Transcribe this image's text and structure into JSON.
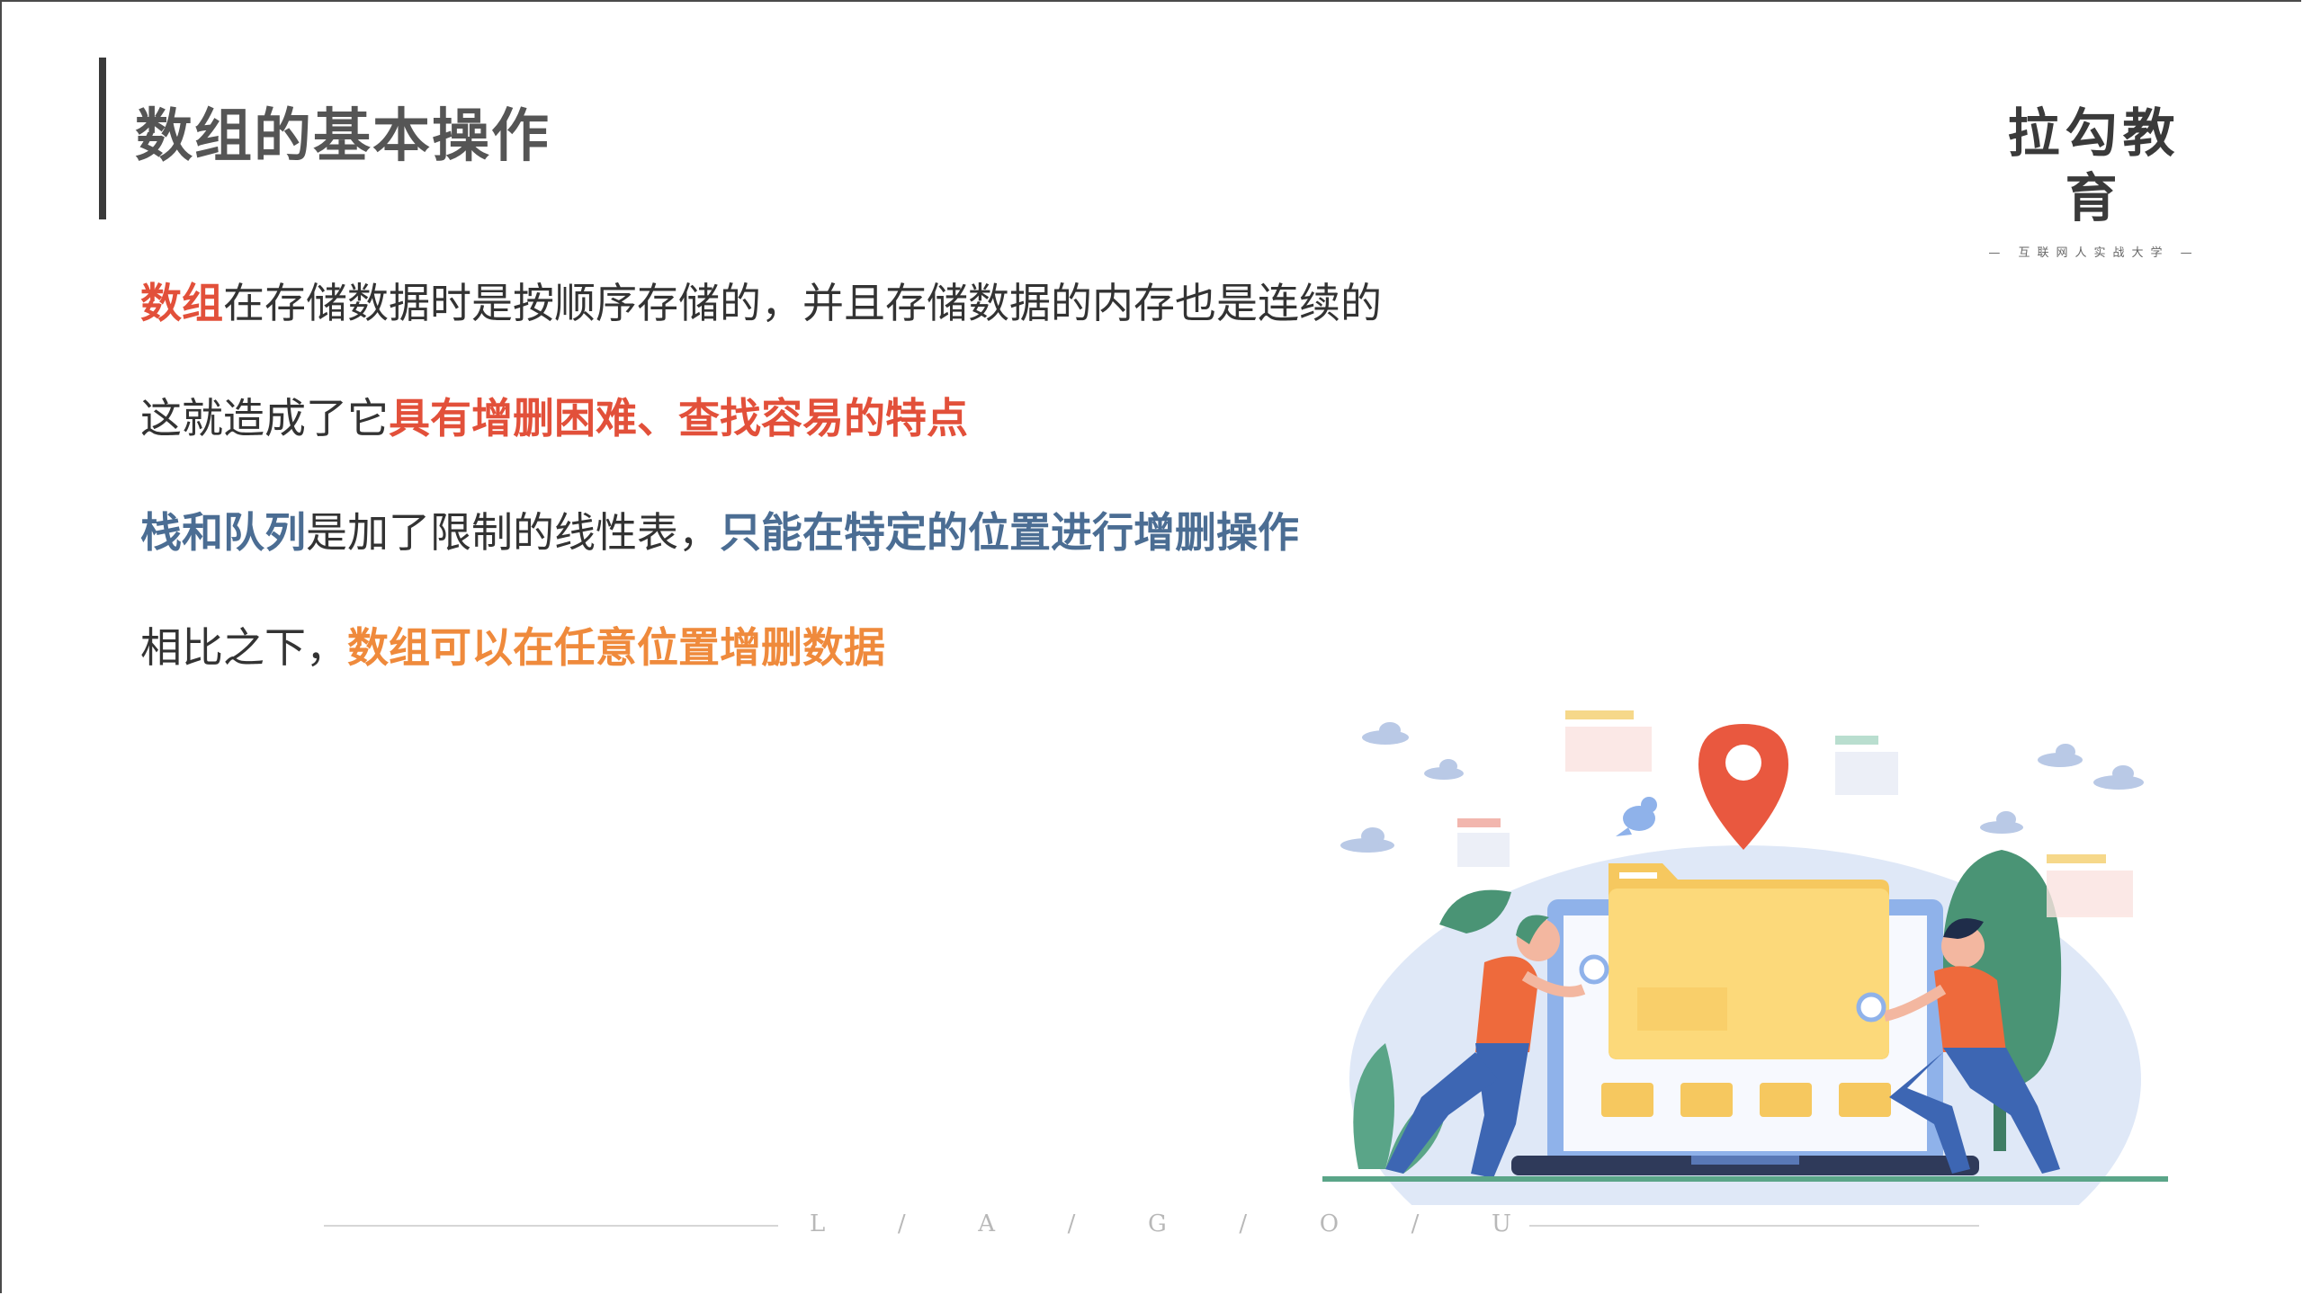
{
  "header": {
    "title": "数组的基本操作",
    "logo_main": "拉勾教育",
    "logo_sub": "— 互联网人实战大学 —"
  },
  "content": {
    "line1": {
      "highlight": "数组",
      "rest": "在存储数据时是按顺序存储的，并且存储数据的内存也是连续的"
    },
    "line2": {
      "prefix": "这就造成了它",
      "highlight": "具有增删困难、查找容易的特点"
    },
    "line3": {
      "highlight1": "栈和队列",
      "middle": "是加了限制的线性表，",
      "highlight2": "只能在特定的位置进行增删操作"
    },
    "line4": {
      "prefix": "相比之下，",
      "highlight": "数组可以在任意位置增删数据"
    }
  },
  "footer": {
    "letters": [
      "L",
      "/",
      "A",
      "/",
      "G",
      "/",
      "O",
      "/",
      "U"
    ]
  },
  "illustration": {
    "icons": [
      "location-pin-icon",
      "folder-icon",
      "laptop-icon",
      "magnifier-icon",
      "bird-icon",
      "cloud-icon",
      "tree-icon",
      "plant-icon"
    ]
  },
  "colors": {
    "red": "#e2503a",
    "blue": "#4b6d93",
    "orange": "#ef8a3c",
    "text": "#333333",
    "title": "#555555"
  }
}
